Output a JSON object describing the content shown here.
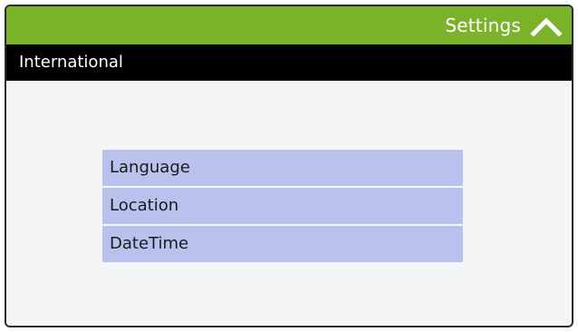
{
  "header": {
    "title": "Settings",
    "up_icon": "chevron-up-icon"
  },
  "subheader": {
    "title": "International"
  },
  "menu": {
    "items": [
      {
        "label": "Language"
      },
      {
        "label": "Location"
      },
      {
        "label": "DateTime"
      }
    ]
  },
  "colors": {
    "header_bg": "#7ab32a",
    "subheader_bg": "#000000",
    "menu_item_bg": "#b9c2ec",
    "content_bg": "#f4f5f6"
  }
}
